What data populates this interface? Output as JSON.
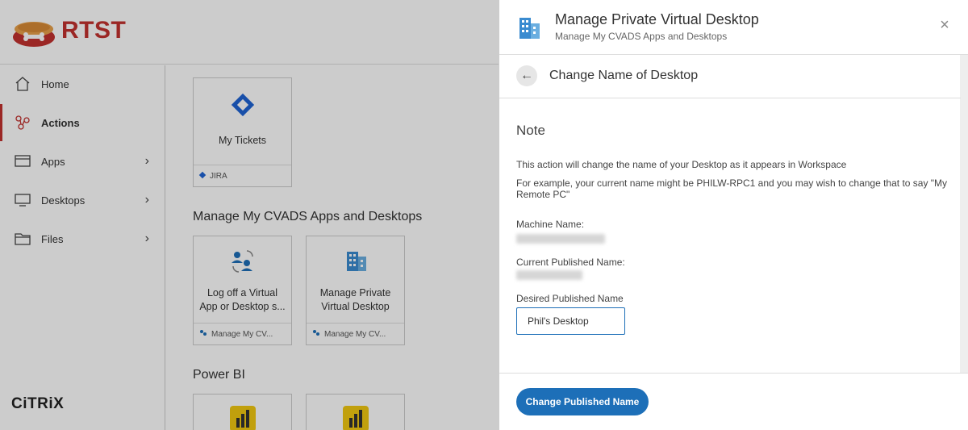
{
  "brand": {
    "name": "RTST",
    "vendor": "CiTRiX",
    "brand_color": "#c2312f"
  },
  "sidebar": {
    "items": [
      {
        "label": "Home",
        "icon": "home-icon"
      },
      {
        "label": "Actions",
        "icon": "actions-icon",
        "active": true
      },
      {
        "label": "Apps",
        "icon": "apps-icon",
        "chevron": "›"
      },
      {
        "label": "Desktops",
        "icon": "desktop-icon",
        "chevron": "›"
      },
      {
        "label": "Files",
        "icon": "folder-icon",
        "chevron": "›"
      }
    ]
  },
  "main": {
    "tiles_top": [
      {
        "label": "My Tickets",
        "footer": "JIRA",
        "icon": "jira-icon"
      }
    ],
    "section_cvads": {
      "title": "Manage My CVADS Apps and Desktops",
      "tiles": [
        {
          "label_line1": "Log off a Virtual",
          "label_line2": "App or Desktop s...",
          "footer": "Manage My CV...",
          "icon": "users-refresh-icon"
        },
        {
          "label_line1": "Manage Private",
          "label_line2": "Virtual Desktop",
          "footer": "Manage My CV...",
          "icon": "building-icon"
        }
      ]
    },
    "section_powerbi": {
      "title": "Power BI"
    }
  },
  "panel": {
    "title": "Manage Private Virtual Desktop",
    "subtitle": "Manage My CVADS Apps and Desktops",
    "close_label": "×",
    "sub_title": "Change Name of Desktop",
    "back_label": "←",
    "note_title": "Note",
    "note_line1": "This action will change the name of your Desktop as it appears in Workspace",
    "note_line2": "For example, your current name might be PHILW-RPC1 and you may wish to change that to say \"My Remote PC\"",
    "machine_name_label": "Machine Name:",
    "current_name_label": "Current Published Name:",
    "desired_name_label": "Desired Published Name",
    "desired_name_value": "Phil's Desktop",
    "submit_label": "Change Published Name",
    "accent": "#1d6fb8"
  }
}
